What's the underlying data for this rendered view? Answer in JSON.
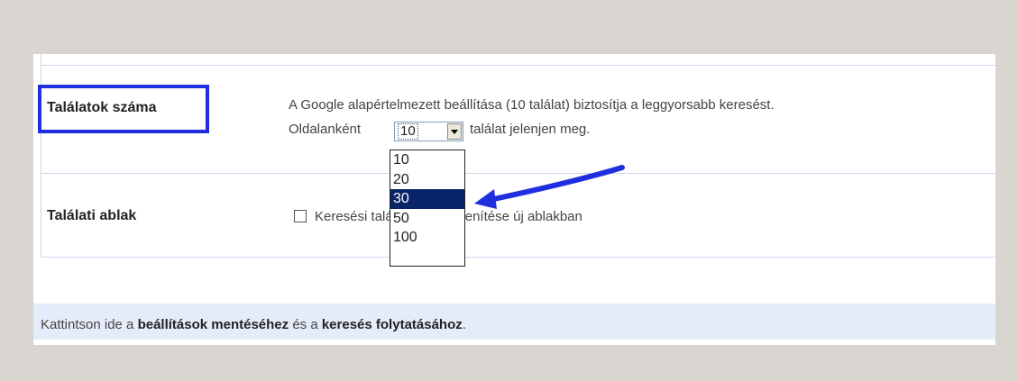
{
  "settings": {
    "results_count": {
      "label": "Találatok száma",
      "description": "A Google alapértelmezett beállítása (10 találat) biztosítja a leggyorsabb keresést.",
      "prefix": "Oldalanként",
      "selected_value": "10",
      "suffix": "találat jelenjen meg.",
      "options": [
        "10",
        "20",
        "30",
        "50",
        "100"
      ],
      "highlighted_option": "30"
    },
    "results_window": {
      "label": "Találati ablak",
      "checkbox_checked": false,
      "checkbox_label": "Keresési találatok megjelenítése új ablakban"
    }
  },
  "footer": {
    "text_before": "Kattintson ide a ",
    "bold1": "beállítások mentéséhez",
    "text_middle": " és a ",
    "bold2": "keresés folytatásához",
    "text_end": "."
  },
  "annotation": {
    "highlight_color": "#1f2fe0",
    "arrow_color": "#1f2fe0"
  }
}
